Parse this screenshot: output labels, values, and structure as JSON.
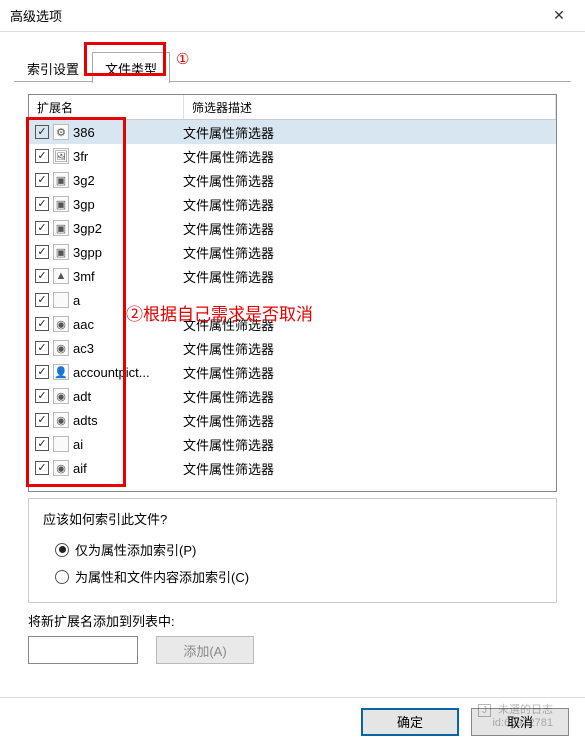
{
  "window": {
    "title": "高级选项"
  },
  "tabs": {
    "index_settings": "索引设置",
    "file_types": "文件类型"
  },
  "annotations": {
    "n1": "①",
    "n2": "②根据自己需求是否取消"
  },
  "list": {
    "col_ext": "扩展名",
    "col_desc": "筛选器描述",
    "desc_default": "文件属性筛选器",
    "rows": [
      {
        "ext": "386",
        "icon": "gear",
        "checked": true,
        "selected": true
      },
      {
        "ext": "3fr",
        "icon": "img",
        "checked": true
      },
      {
        "ext": "3g2",
        "icon": "vid",
        "checked": true
      },
      {
        "ext": "3gp",
        "icon": "vid",
        "checked": true
      },
      {
        "ext": "3gp2",
        "icon": "vid",
        "checked": true
      },
      {
        "ext": "3gpp",
        "icon": "vid",
        "checked": true
      },
      {
        "ext": "3mf",
        "icon": "3d",
        "checked": true
      },
      {
        "ext": "a",
        "icon": "blank",
        "checked": true,
        "desc": ""
      },
      {
        "ext": "aac",
        "icon": "aud",
        "checked": true
      },
      {
        "ext": "ac3",
        "icon": "aud",
        "checked": true
      },
      {
        "ext": "accountpict...",
        "icon": "user",
        "checked": true
      },
      {
        "ext": "adt",
        "icon": "aud",
        "checked": true
      },
      {
        "ext": "adts",
        "icon": "aud",
        "checked": true
      },
      {
        "ext": "ai",
        "icon": "blank",
        "checked": true
      },
      {
        "ext": "aif",
        "icon": "aud",
        "checked": true
      }
    ]
  },
  "index_group": {
    "title": "应该如何索引此文件?",
    "opt_props": "仅为属性添加索引(P)",
    "opt_content": "为属性和文件内容添加索引(C)"
  },
  "add": {
    "label": "将新扩展名添加到列表中:",
    "button": "添加(A)",
    "input_value": ""
  },
  "buttons": {
    "ok": "确定",
    "cancel": "取消"
  },
  "watermark": {
    "line1": "未選的日志",
    "line2": "id:65972781"
  },
  "icon_glyphs": {
    "gear": "⚙",
    "img": "🖼",
    "vid": "▣",
    "3d": "▲",
    "blank": " ",
    "aud": "◉",
    "user": "👤"
  },
  "colors": {
    "annotation_red": "#e60000",
    "selection_blue": "#d8e6f2",
    "primary_border": "#0a64a4"
  }
}
